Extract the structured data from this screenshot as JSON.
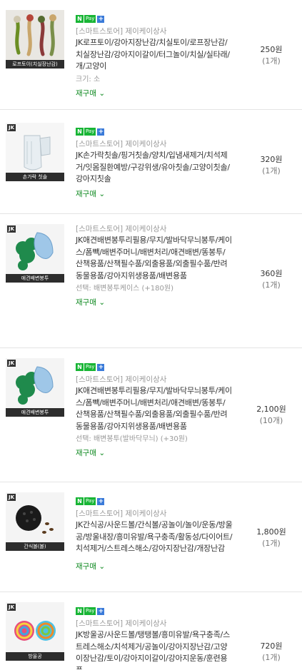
{
  "npay": {
    "n": "N",
    "pay": "Pay",
    "plus": "+"
  },
  "store_name": "[스마트스토어] 제이케이상사",
  "badge": "JK",
  "rebuy_label": "재구매",
  "rebuy_chevron": "⌄",
  "orders": [
    {
      "thumb_caption": "로프토이(치실장난감)",
      "title": "JK로프토이/강아지장난감/치실토이/로프장난감/치실장난감/강아지이갈이/터그놀이/치실/실타래/개/고양이",
      "option": "크기: 소",
      "price": "250원",
      "qty": "(1개)"
    },
    {
      "thumb_caption": "손가락 칫솔",
      "title": "JK손가락칫솔/핑거칫솔/양치/입냄새제거/치석제거/잇몸질환예방/구강위생/유아칫솔/고양이칫솔/강아지칫솔",
      "option": "",
      "price": "320원",
      "qty": "(1개)"
    },
    {
      "thumb_caption": "애견배변봉투",
      "title": "JK애견배변봉투리필용/무지/발바닥무늬봉투/케이스/폼빽/배변주머니/배변처리/애견배변/똥봉투/ 산책용품/산책필수품/외출용품/외출필수품/반려동물용품/강아지위생용품/배변용품",
      "option": "선택: 배변봉투케이스 (+180원)",
      "price": "360원",
      "qty": "(1개)"
    },
    {
      "thumb_caption": "애견배변봉투",
      "title": "JK애견배변봉투리필용/무지/발바닥무늬봉투/케이스/폼빽/배변주머니/배변처리/애견배변/똥봉투/ 산책용품/산책필수품/외출용품/외출필수품/반려동물용품/강아지위생용품/배변용품",
      "option": "선택: 배변봉투(발바닥무늬) (+30원)",
      "price": "2,100원",
      "qty": "(10개)"
    },
    {
      "thumb_caption": "간식볼(볼)",
      "title": "JK간식공/사운드볼/간식볼/공놀이/놀이/운동/방울공/방울내장/흥미유발/욕구충족/활동성/다이어트/치석제거/스트레스해소/강아지장난감/개장난감",
      "option": "",
      "price": "1,800원",
      "qty": "(1개)"
    },
    {
      "thumb_caption": "방울공",
      "title": "JK방울공/사운드볼/탱탱볼/흥미유발/욕구충족/스트레스해소/치석제거/공놀이/강아지장난감/고양이장난감/토이/강아지이갈이/강아지운동/훈련용품",
      "option": "",
      "price": "720원",
      "qty": "(1개)"
    }
  ]
}
